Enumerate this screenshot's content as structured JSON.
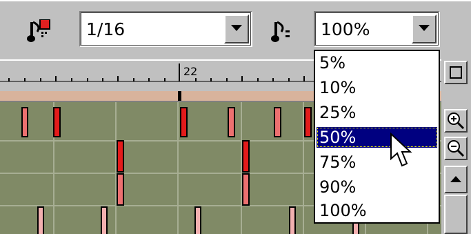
{
  "toolbar": {
    "quantize_icon": "note-quantize-icon",
    "quantize_value": "1/16",
    "velocity_icon": "note-velocity-icon",
    "velocity_value": "100%"
  },
  "ruler": {
    "bar_number": "22"
  },
  "dropdown": {
    "options": [
      "5%",
      "10%",
      "25%",
      "50%",
      "75%",
      "90%",
      "100%"
    ],
    "selected": "50%"
  },
  "scroll": {
    "icons": [
      "square-icon",
      "zoom-in-icon",
      "zoom-out-icon",
      "scroll-up-arrow-icon"
    ]
  },
  "colors": {
    "grid": "#808a66",
    "note_strong": "#e31b1b",
    "note_mid": "#ec7070",
    "note_light": "#f2b0b0",
    "selection": "#000080",
    "ruler_strip": "#d8b39c"
  }
}
